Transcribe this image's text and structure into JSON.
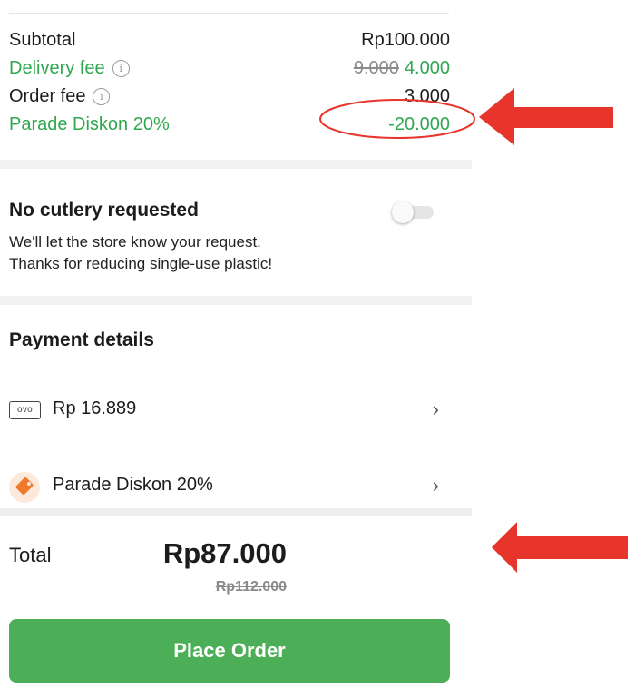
{
  "summary": {
    "subtotal_label": "Subtotal",
    "subtotal_value": "Rp100.000",
    "delivery_label": "Delivery fee",
    "delivery_old": "9.000",
    "delivery_new": "4.000",
    "order_fee_label": "Order fee",
    "order_fee_value": "3.000",
    "discount_label": "Parade Diskon 20%",
    "discount_value": "-20.000",
    "info_icon": "i"
  },
  "cutlery": {
    "title": "No cutlery requested",
    "line1": "We'll let the store know your request.",
    "line2": "Thanks for reducing single-use plastic!",
    "toggle_on": false
  },
  "payment": {
    "title": "Payment details",
    "items": [
      {
        "icon": "ovo-icon",
        "icon_text": "ovo",
        "label": "Rp 16.889"
      },
      {
        "icon": "tag-icon",
        "label": "Parade Diskon 20%"
      }
    ],
    "chevron": "›"
  },
  "total": {
    "label": "Total",
    "value": "Rp87.000",
    "original": "Rp112.000"
  },
  "place_order_label": "Place Order",
  "colors": {
    "green": "#2fa84f",
    "button_green": "#4caf58",
    "annotation_red": "#e8352b"
  }
}
